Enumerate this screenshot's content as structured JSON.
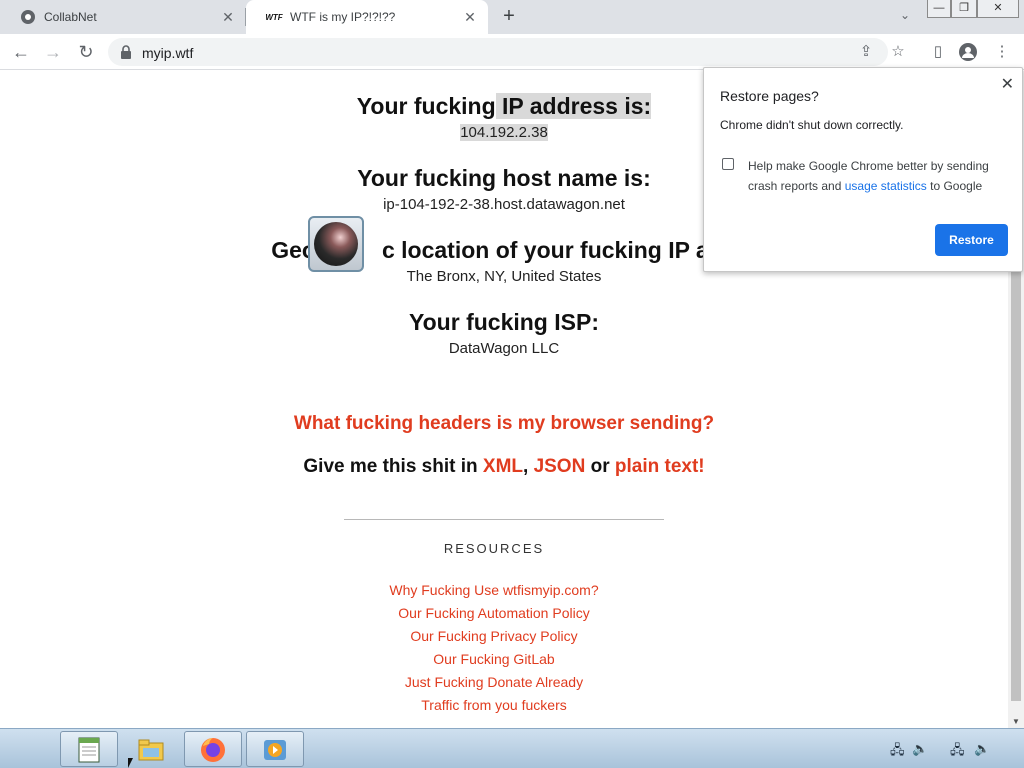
{
  "browser": {
    "tabs": [
      {
        "title": "CollabNet",
        "favicon": "chrome-icon",
        "active": false
      },
      {
        "title": "WTF is my IP?!?!??",
        "favicon": "wtf-icon",
        "active": true
      }
    ],
    "url": "myip.wtf"
  },
  "page": {
    "ip_heading_pre": "Your fucking",
    "ip_heading_hl": " IP address is:",
    "ip_value_pre": "104.192.2",
    "ip_value_hl": ".38",
    "host_heading": "Your fucking host name is:",
    "host_value": "ip-104-192-2-38.host.datawagon.net",
    "geo_heading_a": "Geog",
    "geo_heading_b": "c location of your fucking IP add",
    "geo_value": "The Bronx, NY, United States",
    "isp_heading": "Your fucking ISP:",
    "isp_value": "DataWagon LLC",
    "headers_link": "What fucking headers is my browser sending?",
    "give_text": "Give me this shit in",
    "format_xml": "XML",
    "comma": ",",
    "format_json": "JSON",
    "or_text": "or",
    "format_plain": "plain text!",
    "resources_title": "RESOURCES",
    "resources": [
      "Why Fucking Use wtfismyip.com?",
      "Our Fucking Automation Policy",
      "Our Fucking Privacy Policy",
      "Our Fucking GitLab",
      "Just Fucking Donate Already",
      "Traffic from you fuckers"
    ]
  },
  "popup": {
    "title": "Restore pages?",
    "message": "Chrome didn't shut down correctly.",
    "checkbox_text": "Help make Google Chrome better by sending crash reports and",
    "checkbox_link": "usage statistics",
    "checkbox_suffix": "to Google",
    "restore_button": "Restore"
  },
  "colors": {
    "accent_red": "#e03c1f",
    "chrome_blue": "#1a73e8"
  }
}
